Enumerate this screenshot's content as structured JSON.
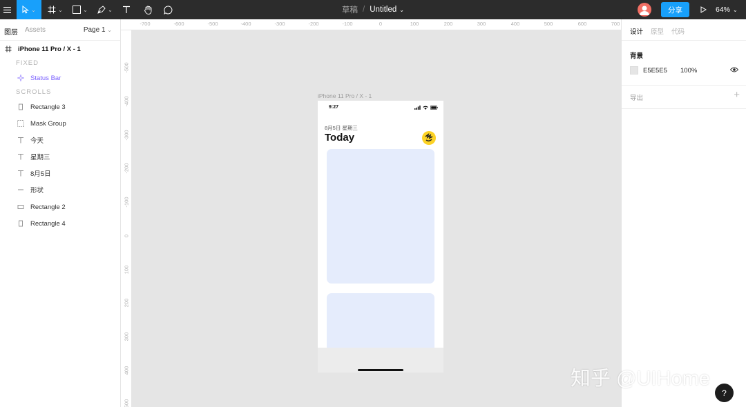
{
  "toolbar": {
    "menu_icon": "hamburger-menu-icon",
    "move_tool_icon": "cursor-arrow-icon",
    "frame_tool_icon": "hash-frame-icon",
    "shape_tool_icon": "square-shape-icon",
    "pen_tool_icon": "pen-icon",
    "text_tool_icon": "text-T-icon",
    "hand_tool_icon": "hand-icon",
    "comment_tool_icon": "comment-bubble-icon",
    "chevron": "⌄",
    "breadcrumb_drafts": "草稿",
    "breadcrumb_sep": "/",
    "file_name": "Untitled",
    "share_label": "分享",
    "play_icon": "play-icon",
    "zoom_label": "64%",
    "active_color": "#18a0fb",
    "bg_color": "#2c2c2c"
  },
  "left_panel": {
    "tabs": [
      "图层",
      "Assets"
    ],
    "page_label": "Page 1",
    "frame_name": "iPhone 11 Pro / X - 1",
    "section_fixed": "FIXED",
    "section_scrolls": "SCROLLS",
    "fixed_layers": [
      {
        "label": "Status Bar",
        "icon": "component-icon",
        "color": "#7b61ff"
      }
    ],
    "layers": [
      {
        "label": "Rectangle 3",
        "icon": "rectangle-icon"
      },
      {
        "label": "Mask Group",
        "icon": "mask-group-icon"
      },
      {
        "label": "今天",
        "icon": "text-icon"
      },
      {
        "label": "星期三",
        "icon": "text-icon"
      },
      {
        "label": "8月5日",
        "icon": "text-icon"
      },
      {
        "label": "形状",
        "icon": "line-icon"
      },
      {
        "label": "Rectangle 2",
        "icon": "rectangle-icon"
      },
      {
        "label": "Rectangle 4",
        "icon": "rectangle-icon"
      }
    ]
  },
  "rulers": {
    "horizontal": [
      "-700",
      "-600",
      "-500",
      "-400",
      "-300",
      "-200",
      "-100",
      "0",
      "100",
      "200",
      "300",
      "400",
      "500",
      "600",
      "700"
    ],
    "vertical": [
      "-500",
      "-400",
      "-300",
      "-200",
      "-100",
      "0",
      "100",
      "200",
      "300",
      "400",
      "500"
    ]
  },
  "frame": {
    "label": "iPhone 11 Pro / X - 1",
    "time": "9:27",
    "date_line": "8月5日  星期三",
    "heading": "Today",
    "card_color": "#e5ecfc",
    "avatar_color": "#fcd225"
  },
  "right_panel": {
    "tabs": [
      "设计",
      "原型",
      "代码"
    ],
    "background_heading": "背景",
    "background_hex": "E5E5E5",
    "background_opacity": "100%",
    "visibility_icon": "eye-icon",
    "export_label": "导出",
    "add_icon": "+"
  },
  "watermark": "知乎 @UIHome",
  "help_label": "?"
}
